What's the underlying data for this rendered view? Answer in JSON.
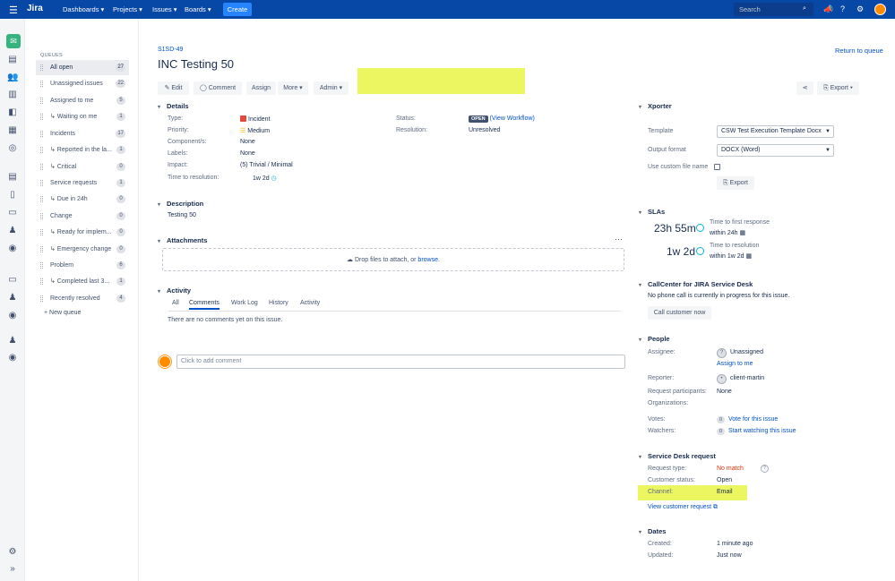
{
  "topbar": {
    "logo": "Jira",
    "nav": [
      "Dashboards ▾",
      "Projects ▾",
      "Issues ▾",
      "Boards ▾"
    ],
    "create": "Create",
    "search_placeholder": "Search"
  },
  "queues": {
    "header": "QUEUES",
    "items": [
      {
        "label": "All open",
        "count": "27"
      },
      {
        "label": "Unassigned issues",
        "count": "22"
      },
      {
        "label": "Assigned to me",
        "count": "5"
      },
      {
        "label": "↳ Waiting on me",
        "count": "1"
      },
      {
        "label": "Incidents",
        "count": "17"
      },
      {
        "label": "↳ Reported in the la...",
        "count": "1"
      },
      {
        "label": "↳ Critical",
        "count": "0"
      },
      {
        "label": "Service requests",
        "count": "1"
      },
      {
        "label": "↳ Due in 24h",
        "count": "0"
      },
      {
        "label": "Change",
        "count": "0"
      },
      {
        "label": "↳ Ready for implem...",
        "count": "0"
      },
      {
        "label": "↳ Emergency change",
        "count": "0"
      },
      {
        "label": "Problem",
        "count": "6"
      },
      {
        "label": "↳ Completed last 3...",
        "count": "1"
      },
      {
        "label": "Recently resolved",
        "count": "4"
      }
    ],
    "new_queue": "+ New queue"
  },
  "issue": {
    "key": "S1SD-49",
    "title": "INC Testing 50",
    "return": "Return to queue",
    "buttons": {
      "edit": "Edit",
      "comment": "Comment",
      "assign": "Assign",
      "more": "More ▾",
      "admin": "Admin ▾",
      "export": "Export ▾"
    },
    "details": {
      "heading": "Details",
      "type_label": "Type:",
      "type": "Incident",
      "priority_label": "Priority:",
      "priority": "Medium",
      "components_label": "Component/s:",
      "components": "None",
      "labels_label": "Labels:",
      "labels": "None",
      "impact_label": "Impact:",
      "impact": "(5) Trivial / Minimal",
      "ttr_label": "Time to resolution:",
      "ttr": "1w 2d",
      "status_label": "Status:",
      "status": "OPEN",
      "workflow": "(View Workflow)",
      "resolution_label": "Resolution:",
      "resolution": "Unresolved"
    },
    "description": {
      "heading": "Description",
      "text": "Testing 50"
    },
    "attachments": {
      "heading": "Attachments",
      "drop": "Drop files to attach, or ",
      "browse": "browse.",
      "more": "···"
    },
    "activity": {
      "heading": "Activity",
      "tabs": [
        "All",
        "Comments",
        "Work Log",
        "History",
        "Activity"
      ],
      "empty": "There are no comments yet on this issue.",
      "placeholder": "Click to add comment"
    }
  },
  "side": {
    "xporter": {
      "heading": "Xporter",
      "template_label": "Template",
      "template": "CSW Test Execution Template Docx",
      "format_label": "Output format",
      "format": "DOCX (Word)",
      "custom_label": "Use custom file name",
      "export": "Export"
    },
    "slas": {
      "heading": "SLAs",
      "items": [
        {
          "time": "23h 55m",
          "name": "Time to first response",
          "goal": "within 24h"
        },
        {
          "time": "1w 2d",
          "name": "Time to resolution",
          "goal": "within 1w 2d"
        }
      ]
    },
    "callcenter": {
      "heading": "CallCenter for JIRA Service Desk",
      "text": "No phone call is currently in progress for this issue.",
      "button": "Call customer now"
    },
    "people": {
      "heading": "People",
      "assignee_label": "Assignee:",
      "assignee": "Unassigned",
      "assign_me": "Assign to me",
      "reporter_label": "Reporter:",
      "reporter": "client-martin",
      "participants_label": "Request participants:",
      "participants": "None",
      "orgs_label": "Organizations:",
      "votes_label": "Votes:",
      "votes": "0",
      "vote_link": "Vote for this issue",
      "watchers_label": "Watchers:",
      "watchers": "0",
      "watch_link": "Start watching this issue"
    },
    "sdr": {
      "heading": "Service Desk request",
      "type_label": "Request type:",
      "type": "No match",
      "status_label": "Customer status:",
      "status": "Open",
      "channel_label": "Channel:",
      "channel": "Email",
      "view": "View customer request"
    },
    "dates": {
      "heading": "Dates",
      "created_label": "Created:",
      "created": "1 minute ago",
      "updated_label": "Updated:",
      "updated": "Just now"
    }
  },
  "colors": {
    "topbar": "#0747a6",
    "link": "#0052cc",
    "highlight": "#ecf660"
  }
}
